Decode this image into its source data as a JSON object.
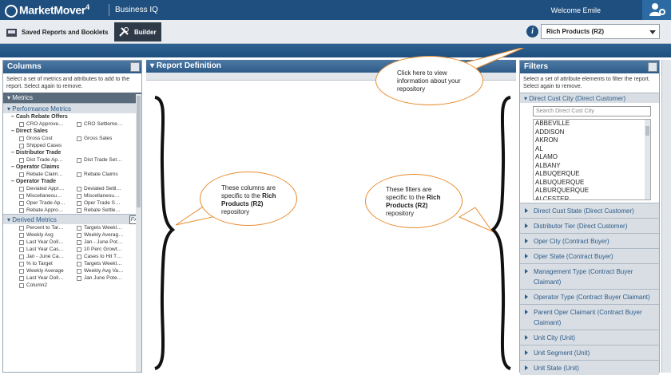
{
  "app": {
    "brand": "MarketMover",
    "brand_version": "4",
    "product": "Business IQ",
    "welcome": "Welcome Emile"
  },
  "toolbar": {
    "saved_reports": "Saved Reports and Booklets",
    "builder": "Builder",
    "info_icon": "i",
    "repository": "Rich Products (R2)"
  },
  "columns_panel": {
    "title": "Columns",
    "description": "Select a set of metrics and attributes to add to the report. Select again to remove.",
    "metrics_label": "Metrics",
    "performance_label": "Performance Metrics",
    "groups": [
      {
        "name": "Cash Rebate Offers",
        "items": [
          "CRO Approve…",
          "CRO Settleme…"
        ]
      },
      {
        "name": "Direct Sales",
        "items": [
          "Gross Cost",
          "Gross Sales",
          "Shipped Cases"
        ]
      },
      {
        "name": "Distributor Trade",
        "items": [
          "Dist Trade Ap…",
          "Dist Trade Set…"
        ]
      },
      {
        "name": "Operator Claims",
        "items": [
          "Rebate Claim…",
          "Rebate Claims"
        ]
      },
      {
        "name": "Operator Trade",
        "items": [
          "Deviated Appr…",
          "Deviated Settl…",
          "Miscellaneou…",
          "Miscellaneou…",
          "Oper Trade Ap…",
          "Oper Trade S…",
          "Rebate Appro…",
          "Rebate Settle…"
        ]
      }
    ],
    "derived_label": "Derived Metrics",
    "fx_label": "Fx",
    "derived_items": [
      "Percent to Tar…",
      "Targets Weekl…",
      "Weekly Avg",
      "Weekly Averag…",
      "Last Year Doll…",
      "Jan - June Pot…",
      "Last Year Cas…",
      "10 Perc Growt…",
      "Jan - June Ca…",
      "Cases to Hit T…",
      "% to Target",
      "Targets Weekl…",
      "Weekly Average",
      "Weekly Avg Va…",
      "Last Year Doll…",
      "Jan June Pote…",
      "Column2"
    ]
  },
  "report_panel": {
    "title": "Report Definition"
  },
  "filters_panel": {
    "title": "Filters",
    "description": "Select a set of attribute elements to filter the report. Select again to remove.",
    "expanded": "Direct Cust City (Direct Customer)",
    "search_placeholder": "Search Direct Cust City",
    "cities": [
      "ABBEVILLE",
      "ADDISON",
      "AKRON",
      "AL",
      "ALAMO",
      "ALBANY",
      "ALBUQERQUE",
      "ALBUQUERQUE",
      "ALBURQUERQUE",
      "ALCESTER"
    ],
    "collapsed": [
      "Direct Cust State (Direct Customer)",
      "Distributor Tier (Direct Customer)",
      "Oper City (Contract Buyer)",
      "Oper State (Contract Buyer)",
      "Management Type (Contract Buyer Claimant)",
      "Operator Type (Contract Buyer Claimant)",
      "Parent Oper Claimant (Contract Buyer Claimant)",
      "Unit City (Unit)",
      "Unit Segment (Unit)",
      "Unit State (Unit)"
    ]
  },
  "callouts": {
    "info": "Click here to view information about your repository",
    "columns_pre": "These columns are specific to the ",
    "columns_bold": "Rich Products (R2)",
    "columns_post": " repository",
    "filters_pre": "These filters are specific to the ",
    "filters_bold": "Rich Products (R2)",
    "filters_post": " repository"
  },
  "colors": {
    "header_blue": "#1f4f7e",
    "callout_orange": "#e88b2e",
    "panel_head": "#2d5b89"
  }
}
